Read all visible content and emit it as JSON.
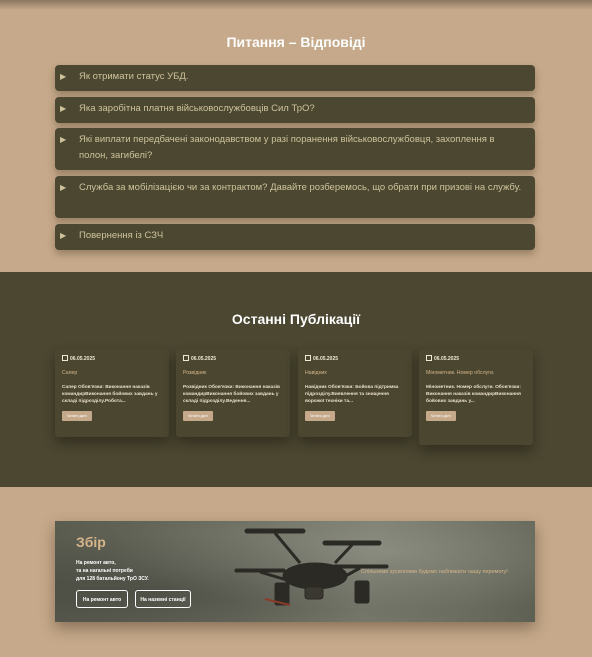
{
  "faq": {
    "title": "Питання – Відповіді",
    "items": [
      {
        "label": "Як отримати статус УБД."
      },
      {
        "label": "Яка заробітна платня військовослужбовців Сил ТрО?"
      },
      {
        "label": "Які виплати передбачені законодавством у разі поранення військовослужбовця, захоплення в полон, загибелі?"
      },
      {
        "label": "Служба за мобілізацією чи за контрактом? Давайте розберемось, що обрати при призові на службу."
      },
      {
        "label": "Повернення із СЗЧ"
      }
    ]
  },
  "publications": {
    "title": "Останні Публікації",
    "cards": [
      {
        "date": "06.05.2025",
        "category": "Сапер",
        "text": "Сапер Обов'язки: Виконання наказів командирВиконання бойових завдань у складі підрозділу.Робота...",
        "button": "Читати далі"
      },
      {
        "date": "06.05.2025",
        "category": "Розвідник",
        "text": "Розвідник Обов'язки: Виконання наказів командирВиконання бойових завдань у складі підрозділу.Ведення...",
        "button": "Читати далі"
      },
      {
        "date": "06.05.2025",
        "category": "Навідник",
        "text": "Навідник Обов'язки: Бойова підтримка підрозділу.Виявлення та знищення ворожої техніки та...",
        "button": "Читати далі"
      },
      {
        "date": "06.05.2025",
        "category": "Мінометник. Номер обслуги.",
        "text": "Мінометник. Номер обслуги. Обов'язки: Виконання наказів командирВиконання бойових завдань у...",
        "button": "Читати далі"
      }
    ]
  },
  "fundraising": {
    "title": "Збір",
    "desc_line1": "На ремонт авто,",
    "desc_line2": "та на нагальні потреби",
    "desc_line3": "для 128 батальйону ТрО ЗСУ.",
    "button_car": "На ремонт авто",
    "button_station": "На наземні станції",
    "slogan": "Спільними зусиллями будемо наближати нашу перемогу!"
  },
  "icons": {
    "faq_marker": "triangle-right-icon",
    "date": "calendar-icon",
    "banner_image": "drone-icon"
  },
  "colors": {
    "accent": "#c6a98a",
    "dark": "#4b4731",
    "gold": "#d7b68a"
  }
}
